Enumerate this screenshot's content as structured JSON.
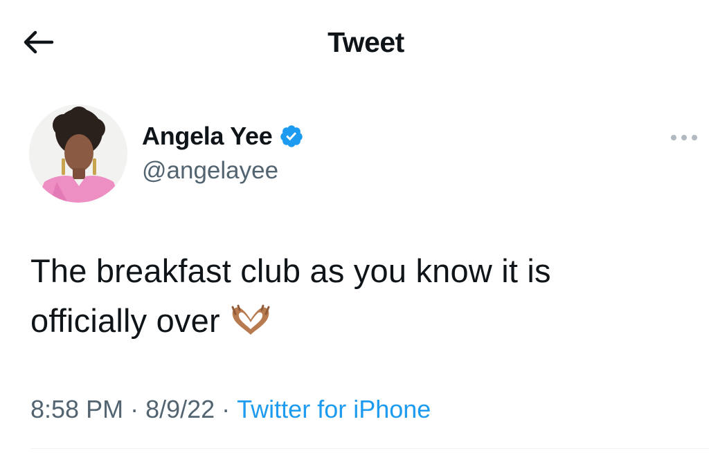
{
  "header": {
    "title": "Tweet",
    "back_icon": "arrow-left-icon"
  },
  "author": {
    "display_name": "Angela Yee",
    "handle": "@angelayee",
    "verified": true,
    "verified_icon": "verified-badge-icon",
    "avatar_icon": "profile-photo"
  },
  "more_icon": "more-horizontal-icon",
  "tweet": {
    "line1": "The breakfast club as you know it is",
    "line2": "officially over",
    "emoji": "heart-hands-emoji"
  },
  "meta": {
    "time": "8:58 PM",
    "separator": "·",
    "date": "8/9/22",
    "source": "Twitter for iPhone"
  },
  "colors": {
    "text": "#0f1419",
    "secondary": "#536471",
    "accent": "#1d9bf0"
  }
}
